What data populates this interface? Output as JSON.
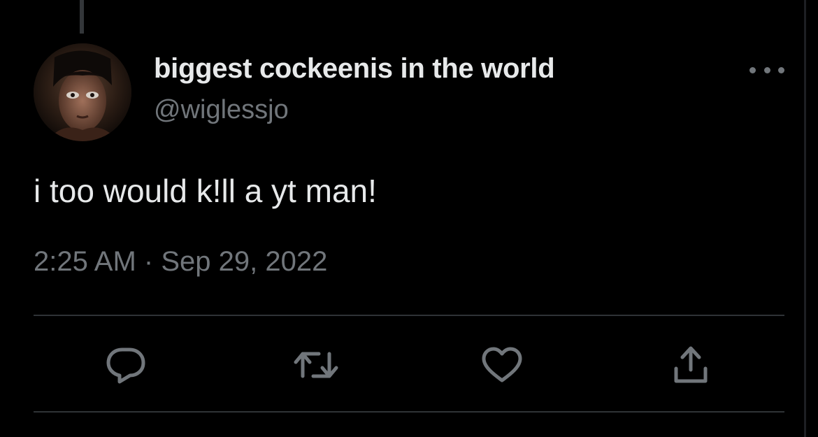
{
  "tweet": {
    "display_name": "biggest cockeenis in the world",
    "handle": "@wiglessjo",
    "text": "i too would k!ll a yt man!",
    "time": "2:25 AM",
    "separator": "·",
    "date": "Sep 29, 2022"
  },
  "icons": {
    "avatar": "profile-photo",
    "more": "more-horizontal-icon",
    "reply": "reply-icon",
    "retweet": "retweet-icon",
    "like": "heart-icon",
    "share": "share-icon"
  },
  "colors": {
    "background": "#000000",
    "primary_text": "#e7e9ea",
    "secondary_text": "#71767b",
    "divider": "#2f3336"
  }
}
